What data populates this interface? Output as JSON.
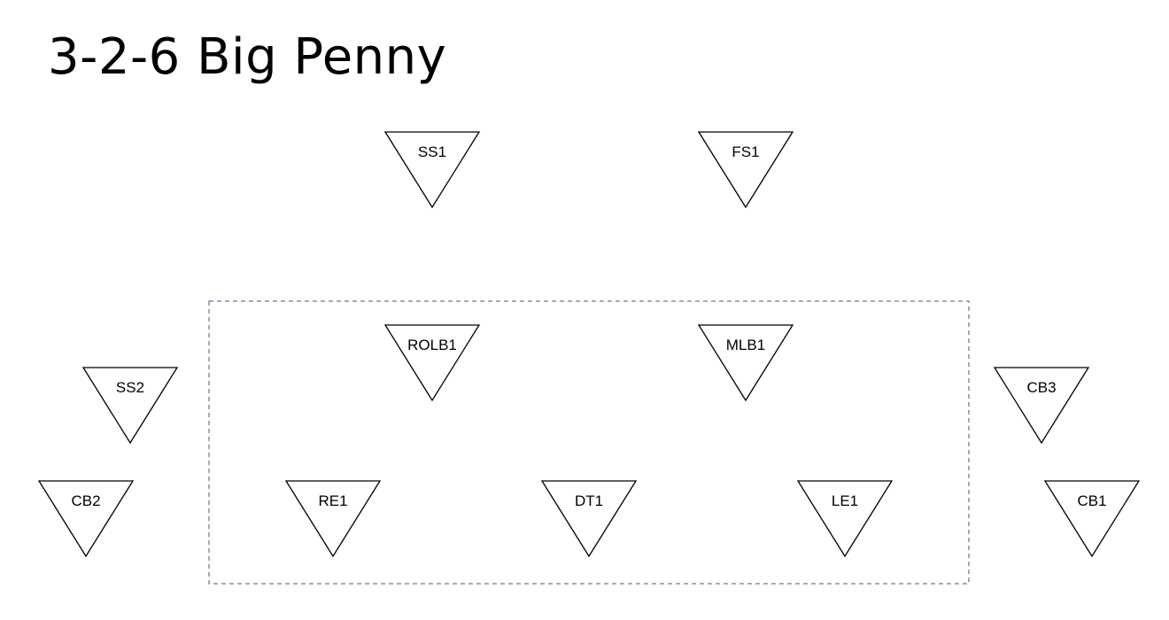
{
  "title": "3-2-6 Big Penny",
  "colors": {
    "background": "#ffffff",
    "marker_stroke": "#000000",
    "box_stroke": "#7f8fa6"
  },
  "players": [
    {
      "label": "SS1"
    },
    {
      "label": "FS1"
    },
    {
      "label": "ROLB1"
    },
    {
      "label": "MLB1"
    },
    {
      "label": "SS2"
    },
    {
      "label": "CB3"
    },
    {
      "label": "CB2"
    },
    {
      "label": "RE1"
    },
    {
      "label": "DT1"
    },
    {
      "label": "LE1"
    },
    {
      "label": "CB1"
    }
  ]
}
